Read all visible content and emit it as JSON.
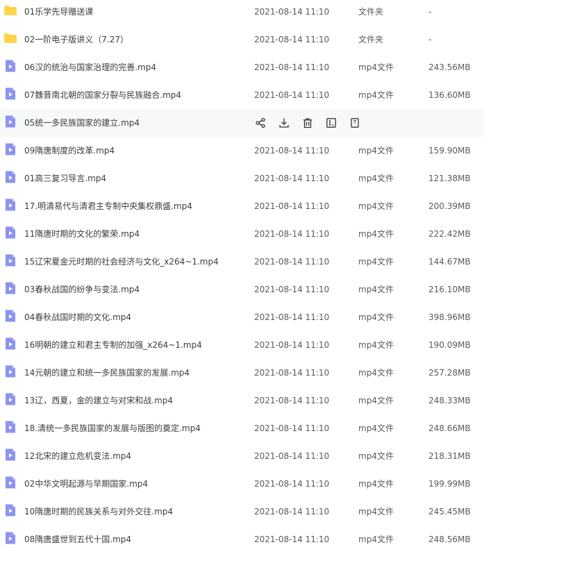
{
  "file_list": {
    "hovered_index": 4,
    "rows": [
      {
        "name": "01乐学先导赠送课",
        "date": "2021-08-14 11:10",
        "type": "文件夹",
        "size": "-",
        "icon": "folder-icon"
      },
      {
        "name": "02一阶电子版讲义（7.27）",
        "date": "2021-08-14 11:10",
        "type": "文件夹",
        "size": "-",
        "icon": "folder-icon"
      },
      {
        "name": "06汉的统治与国家治理的完善.mp4",
        "date": "2021-08-14 11:10",
        "type": "mp4文件",
        "size": "243.56MB",
        "icon": "video-file-icon"
      },
      {
        "name": "07魏晋南北朝的国家分裂与民族融合.mp4",
        "date": "2021-08-14 11:10",
        "type": "mp4文件",
        "size": "136.60MB",
        "icon": "video-file-icon"
      },
      {
        "name": "05统一多民族国家的建立.mp4",
        "date": "",
        "type": "",
        "size": "",
        "icon": "video-file-icon"
      },
      {
        "name": "09隋唐制度的改革.mp4",
        "date": "2021-08-14 11:10",
        "type": "mp4文件",
        "size": "159.90MB",
        "icon": "video-file-icon"
      },
      {
        "name": "01高三复习导言.mp4",
        "date": "2021-08-14 11:10",
        "type": "mp4文件",
        "size": "121.38MB",
        "icon": "video-file-icon"
      },
      {
        "name": "17.明清易代与清君主专制中央集权鼎盛.mp4",
        "date": "2021-08-14 11:10",
        "type": "mp4文件",
        "size": "200.39MB",
        "icon": "video-file-icon"
      },
      {
        "name": "11隋唐时期的文化的繁荣.mp4",
        "date": "2021-08-14 11:10",
        "type": "mp4文件",
        "size": "222.42MB",
        "icon": "video-file-icon"
      },
      {
        "name": "15辽宋夏金元时期的社会经济与文化_x264~1.mp4",
        "date": "2021-08-14 11:10",
        "type": "mp4文件",
        "size": "144.67MB",
        "icon": "video-file-icon"
      },
      {
        "name": "03春秋战国的纷争与变法.mp4",
        "date": "2021-08-14 11:10",
        "type": "mp4文件",
        "size": "216.10MB",
        "icon": "video-file-icon"
      },
      {
        "name": "04春秋战国时期的文化.mp4",
        "date": "2021-08-14 11:10",
        "type": "mp4文件",
        "size": "398.96MB",
        "icon": "video-file-icon"
      },
      {
        "name": "16明朝的建立和君主专制的加强_x264~1.mp4",
        "date": "2021-08-14 11:10",
        "type": "mp4文件",
        "size": "190.09MB",
        "icon": "video-file-icon"
      },
      {
        "name": "14元朝的建立和统一多民族国家的发展.mp4",
        "date": "2021-08-14 11:10",
        "type": "mp4文件",
        "size": "257.28MB",
        "icon": "video-file-icon"
      },
      {
        "name": "13辽，西夏，金的建立与对宋和战.mp4",
        "date": "2021-08-14 11:10",
        "type": "mp4文件",
        "size": "248.33MB",
        "icon": "video-file-icon"
      },
      {
        "name": "18.清统一多民族国家的发展与版图的奠定.mp4",
        "date": "2021-08-14 11:10",
        "type": "mp4文件",
        "size": "248.66MB",
        "icon": "video-file-icon"
      },
      {
        "name": "12北宋的建立危机变法.mp4",
        "date": "2021-08-14 11:10",
        "type": "mp4文件",
        "size": "218.31MB",
        "icon": "video-file-icon"
      },
      {
        "name": "02中华文明起源与早期国家.mp4",
        "date": "2021-08-14 11:10",
        "type": "mp4文件",
        "size": "199.99MB",
        "icon": "video-file-icon"
      },
      {
        "name": "10隋唐时期的民族关系与对外交往.mp4",
        "date": "2021-08-14 11:10",
        "type": "mp4文件",
        "size": "245.45MB",
        "icon": "video-file-icon"
      },
      {
        "name": "08隋唐盛世到五代十国.mp4",
        "date": "2021-08-14 11:10",
        "type": "mp4文件",
        "size": "248.56MB",
        "icon": "video-file-icon"
      }
    ],
    "hover_actions": [
      {
        "id": "share",
        "icon": "share-icon"
      },
      {
        "id": "download",
        "icon": "download-icon"
      },
      {
        "id": "delete",
        "icon": "trash-icon"
      },
      {
        "id": "rename",
        "icon": "rename-icon"
      },
      {
        "id": "more",
        "icon": "more-icon"
      }
    ]
  },
  "colors": {
    "folder": "#ffd54a",
    "video": "#8c93f0",
    "hover_bg": "#f7f8fa",
    "text": "#3c3c3c",
    "muted": "#5a5a5a",
    "action_icon": "#333333"
  }
}
